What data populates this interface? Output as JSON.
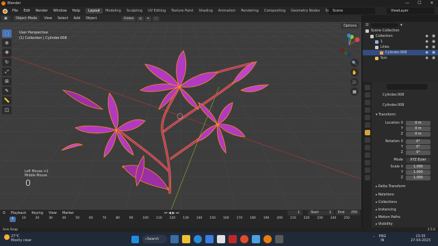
{
  "window": {
    "title": "Blender"
  },
  "menu": {
    "items": [
      "File",
      "Edit",
      "Render",
      "Window",
      "Help"
    ]
  },
  "workspaces": {
    "tabs": [
      "Layout",
      "Modeling",
      "Sculpting",
      "UV Editing",
      "Texture Paint",
      "Shading",
      "Animation",
      "Rendering",
      "Compositing",
      "Geometry Nodes",
      "Scripting"
    ],
    "active": "Layout"
  },
  "scene": {
    "name": "Scene"
  },
  "view_layer": {
    "name": "ViewLayer"
  },
  "header": {
    "mode": "Object Mode",
    "view": "View",
    "select": "Select",
    "add": "Add",
    "object": "Object",
    "orientation": "Global",
    "options": "Options"
  },
  "viewport": {
    "perspective": "User Perspective",
    "context": "(1) Collection | Cylinder.008",
    "mouse_hint_1": "Left Mouse ×2",
    "mouse_hint_2": "Middle Mouse"
  },
  "timeline": {
    "playback": "Playback",
    "keying": "Keying",
    "view": "View",
    "marker": "Marker",
    "current_frame": "1",
    "start_label": "Start",
    "start": "1",
    "end_label": "End",
    "end": "250",
    "ruler": [
      "10",
      "20",
      "30",
      "40",
      "50",
      "60",
      "70",
      "80",
      "90",
      "100",
      "110",
      "120",
      "130",
      "140",
      "150",
      "160",
      "170",
      "180",
      "190",
      "200",
      "210",
      "220",
      "230",
      "240",
      "250"
    ],
    "cursor": "1"
  },
  "status": {
    "text": "Axis Snap",
    "version": "3.5.0"
  },
  "outliner": {
    "items": [
      {
        "label": "Scene Collection",
        "indent": 0,
        "color": "#cccccc"
      },
      {
        "label": "Collection",
        "indent": 1,
        "color": "#cccccc"
      },
      {
        "label": "1",
        "indent": 2,
        "color": "#8fb3e6"
      },
      {
        "label": "Lilies",
        "indent": 2,
        "color": "#cccccc"
      },
      {
        "label": "Cylinder.008",
        "indent": 3,
        "color": "#f0a050",
        "selected": true
      },
      {
        "label": "Sun",
        "indent": 2,
        "color": "#f0c060"
      }
    ]
  },
  "properties": {
    "object_name": "Cylinder.008",
    "data_name": "Cylinder.008",
    "transform_label": "Transform",
    "location": {
      "label": "Location X",
      "x": "0 m",
      "y": "0 m",
      "z": "0 m"
    },
    "rotation": {
      "label": "Rotation X",
      "x": "0°",
      "y": "0°",
      "z": "0°"
    },
    "mode": {
      "label": "Mode",
      "value": "XYZ Euler"
    },
    "scale": {
      "label": "Scale X",
      "x": "1.000",
      "y": "1.000",
      "z": "1.000"
    },
    "axis_y": "Y",
    "axis_z": "Z",
    "sections": [
      "Delta Transform",
      "Relations",
      "Collections",
      "Instancing",
      "Motion Paths",
      "Visibility"
    ]
  },
  "taskbar": {
    "weather_temp": "27°C",
    "weather_desc": "Mostly clear",
    "search": "Search",
    "lang_1": "ENG",
    "lang_2": "IN",
    "time": "23:35",
    "date": "27-04-2023"
  },
  "colors": {
    "accent": "#4772b3",
    "flower": "#b23ac0",
    "selection_outline": "#ff8c1a",
    "stem": "#b7327a",
    "grid": "#4a4a4a"
  }
}
